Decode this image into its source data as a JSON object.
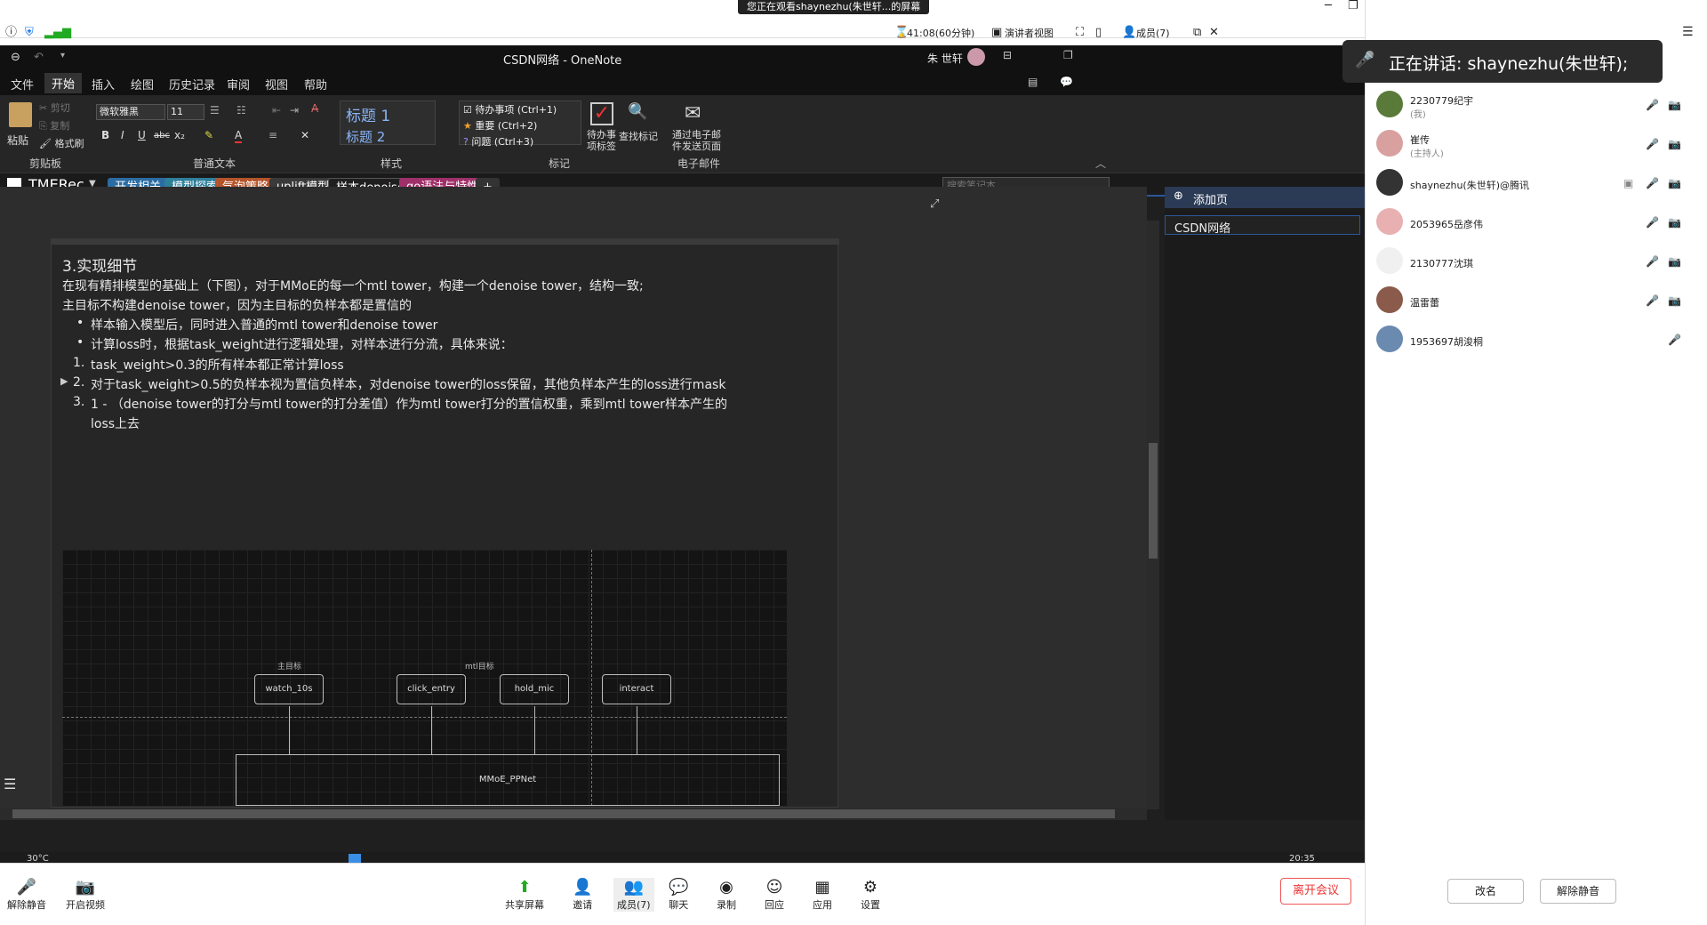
{
  "meeting_bar": {
    "viewing_banner": "您正在观看shaynezhu(朱世轩...的屏幕",
    "timer": "41:08(60分钟)",
    "view_mode": "演讲者视图",
    "members": "成员(7)"
  },
  "onenote": {
    "window_title": "CSDN网络 - OneNote",
    "user_name": "朱 世轩",
    "ribbon_tabs": [
      "文件",
      "开始",
      "插入",
      "绘图",
      "历史记录",
      "审阅",
      "视图",
      "帮助"
    ],
    "active_tab": "开始",
    "clipboard": {
      "paste": "粘贴",
      "cut": "剪切",
      "copy": "复制",
      "format_painter": "格式刷",
      "group": "剪贴板"
    },
    "font": {
      "name": "微软雅黑",
      "size": "11",
      "group": "普通文本"
    },
    "styles": {
      "h1": "标题 1",
      "h2": "标题 2",
      "group": "样式"
    },
    "tags": {
      "todo": "待办事项 (Ctrl+1)",
      "important": "重要 (Ctrl+2)",
      "question": "问题 (Ctrl+3)",
      "todo_tag": "待办事项标签",
      "find_tags": "查找标记",
      "group": "标记"
    },
    "email": {
      "label": "通过电子邮件发送页面",
      "group": "电子邮件"
    },
    "notebook": "TMERec",
    "sections": [
      {
        "label": "开发相关",
        "color": "#2b6ca3"
      },
      {
        "label": "模型探索",
        "color": "#2e7f9a"
      },
      {
        "label": "气泡策略",
        "color": "#b5542a"
      },
      {
        "label": "uplift模型",
        "color": "#3a3a3a"
      },
      {
        "label": "样本denoise",
        "color": "#1f1f1f"
      },
      {
        "label": "go语法与特性",
        "color": "#a0306a"
      }
    ],
    "add_section": "+",
    "search_placeholder": "搜索笔记本",
    "add_page": "添加页",
    "pages": [
      "CSDN网络"
    ],
    "note": {
      "heading": "3.实现细节",
      "lines": [
        "在现有精排模型的基础上（下图），对于MMoE的每一个mtl tower，构建一个denoise tower，结构一致;",
        "主目标不构建denoise tower，因为主目标的负样本都是置信的"
      ],
      "bullets": [
        "样本输入模型后，同时进入普通的mtl tower和denoise tower",
        "计算loss时，根据task_weight进行逻辑处理，对样本进行分流，具体来说："
      ],
      "numbered": [
        "task_weight>0.3的所有样本都正常计算loss",
        "对于task_weight>0.5的负样本视为置信负样本，对denoise tower的loss保留，其他负样本产生的loss进行mask",
        "1 - （denoise tower的打分与mtl tower的打分差值）作为mtl tower打分的置信权重，乘到mtl tower样本产生的",
        "loss上去"
      ],
      "numbers": [
        "1.",
        "2.",
        "3."
      ]
    },
    "diagram": {
      "main_label": "主目标",
      "mtl_label": "mtl目标",
      "boxes": [
        "watch_10s",
        "click_entry",
        "hold_mic",
        "interact"
      ],
      "base": "MMoE_PPNet"
    }
  },
  "taskbar": {
    "temp": "30°C",
    "time": "20:35"
  },
  "bottom_bar": {
    "unmute": "解除静音",
    "video": "开启视频",
    "share": "共享屏幕",
    "invite": "邀请",
    "members": "成员(7)",
    "chat": "聊天",
    "record": "录制",
    "reply": "回应",
    "apps": "应用",
    "settings": "设置",
    "leave": "离开会议"
  },
  "participants": {
    "speaking": "正在讲话:  shaynezhu(朱世轩);",
    "list": [
      {
        "name": "2230779纪宇",
        "sub": "(我)"
      },
      {
        "name": "崔传",
        "sub": "(主持人)"
      },
      {
        "name": "shaynezhu(朱世轩)@腾讯",
        "sub": ""
      },
      {
        "name": "2053965岳彦伟",
        "sub": ""
      },
      {
        "name": "2130777沈琪",
        "sub": ""
      },
      {
        "name": "温雷蕾",
        "sub": ""
      },
      {
        "name": "1953697胡浚桐",
        "sub": ""
      }
    ],
    "rename": "改名",
    "unmute_all": "解除静音"
  }
}
